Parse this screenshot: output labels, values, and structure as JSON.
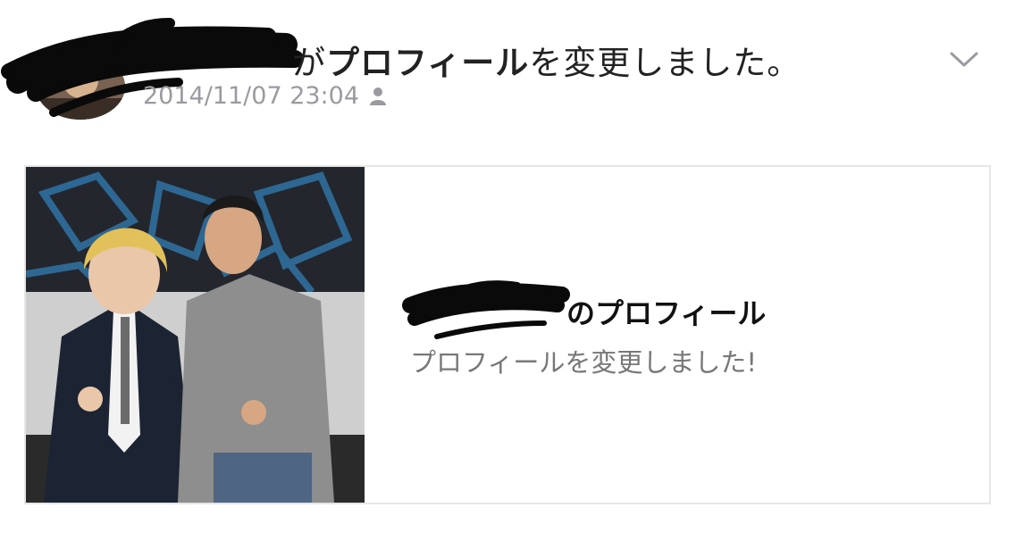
{
  "header": {
    "name_suffix": "が",
    "action_bold": "プロフィール",
    "action_rest": "を変更しました。",
    "timestamp": "2014/11/07 23:04",
    "visibility_icon": "person-icon",
    "menu_icon": "chevron-down-icon"
  },
  "card": {
    "title_suffix": "のプロフィール",
    "subtitle": "プロフィールを変更しました!",
    "photo_alt": "profile-photo"
  }
}
